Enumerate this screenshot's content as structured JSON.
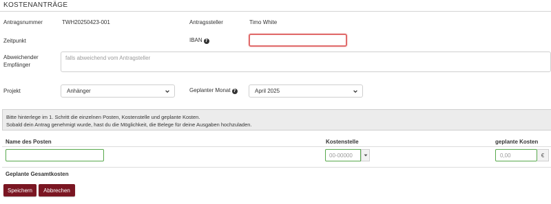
{
  "header": {
    "title": "KOSTENANTRÄGE"
  },
  "form": {
    "antragsnummer_label": "Antragsnummer",
    "antragsnummer_value": "TWH20250423-001",
    "antragsteller_label": "Antragssteller",
    "antragsteller_value": "Timo White",
    "zeitpunkt_label": "Zeitpunkt",
    "iban_label": "IBAN",
    "iban_value": "",
    "empfaenger_label_1": "Abweichender",
    "empfaenger_label_2": "Empfänger",
    "empfaenger_placeholder": "falls abweichend vom Antragsteller",
    "projekt_label": "Projekt",
    "projekt_selected": "Anhänger",
    "monat_label": "Geplanter Monat",
    "monat_selected": "April 2025"
  },
  "info": {
    "line1": "Bitte hinterlege im 1. Schritt die einzelnen Posten, Kostenstelle und geplante Kosten.",
    "line2": "Sobald dein Antrag genehmigt wurde, hast du die Möglichkeit, die Belege für deine Ausgaben hochzuladen."
  },
  "table": {
    "col_name": "Name des Posten",
    "col_kostenstelle": "Kostenstelle",
    "col_kosten": "geplante Kosten",
    "row": {
      "name_value": "",
      "kostenstelle_placeholder": "00-00000",
      "kosten_placeholder": "0,00",
      "currency": "€"
    },
    "total_label": "Geplante Gesamtkosten"
  },
  "buttons": {
    "save": "Speichern",
    "cancel": "Abbrechen"
  },
  "icons": {
    "help": "question-circle-icon",
    "dropdown": "chevron-down-icon"
  },
  "colors": {
    "primary": "#7a1622",
    "error": "#e06a6a",
    "valid": "#55a84a",
    "info_bg": "#ececec"
  }
}
